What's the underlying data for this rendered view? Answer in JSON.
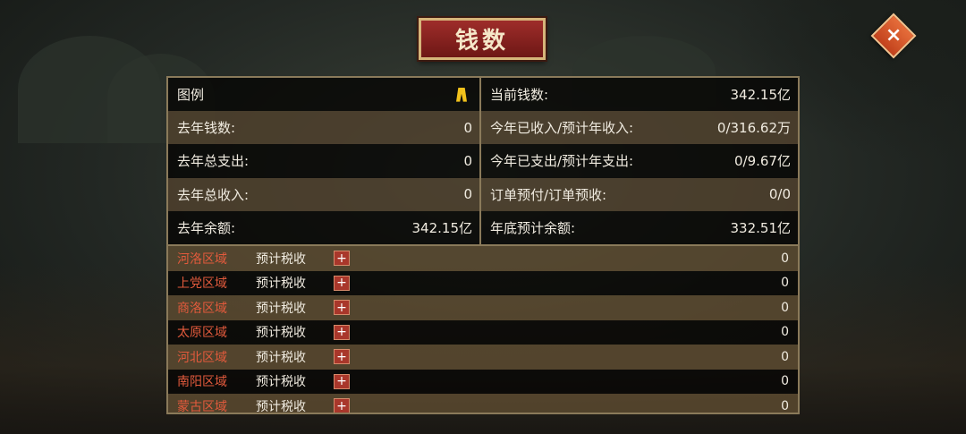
{
  "title": "钱数",
  "close_icon": "×",
  "summary": {
    "left": [
      {
        "label": "图例",
        "value": "",
        "icon": "legend-icon"
      },
      {
        "label": "去年钱数:",
        "value": "0"
      },
      {
        "label": "去年总支出:",
        "value": "0"
      },
      {
        "label": "去年总收入:",
        "value": "0"
      },
      {
        "label": "去年余额:",
        "value": "342.15亿"
      }
    ],
    "right": [
      {
        "label": "当前钱数:",
        "value": "342.15亿"
      },
      {
        "label": "今年已收入/预计年收入:",
        "value": "0/316.62万"
      },
      {
        "label": "今年已支出/预计年支出:",
        "value": "0/9.67亿"
      },
      {
        "label": "订单预付/订单预收:",
        "value": "0/0"
      },
      {
        "label": "年底预计余额:",
        "value": "332.51亿"
      }
    ]
  },
  "regions": [
    {
      "name": "河洛区域",
      "label": "预计税收",
      "plus": "+",
      "value": "0"
    },
    {
      "name": "上党区域",
      "label": "预计税收",
      "plus": "+",
      "value": "0"
    },
    {
      "name": "商洛区域",
      "label": "预计税收",
      "plus": "+",
      "value": "0"
    },
    {
      "name": "太原区域",
      "label": "预计税收",
      "plus": "+",
      "value": "0"
    },
    {
      "name": "河北区域",
      "label": "预计税收",
      "plus": "+",
      "value": "0"
    },
    {
      "name": "南阳区域",
      "label": "预计税收",
      "plus": "+",
      "value": "0"
    },
    {
      "name": "蒙古区域",
      "label": "预计税收",
      "plus": "+",
      "value": "0"
    }
  ]
}
